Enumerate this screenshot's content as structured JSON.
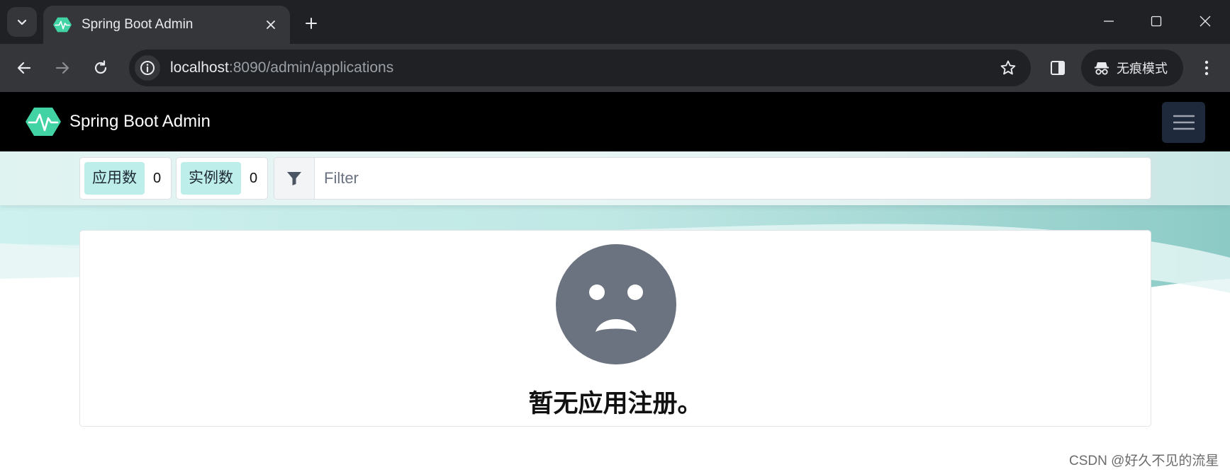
{
  "browser": {
    "tab": {
      "title": "Spring Boot Admin"
    },
    "address_bar": {
      "host": "localhost",
      "path": ":8090/admin/applications"
    },
    "incognito_label": "无痕模式",
    "icons": {
      "tab_search": "chevron-down-icon",
      "tab_close": "close-icon",
      "new_tab": "plus-icon",
      "minimize": "minimize-icon",
      "maximize": "maximize-icon",
      "close_window": "close-icon",
      "back": "arrow-left-icon",
      "forward": "arrow-right-icon",
      "reload": "reload-icon",
      "site_info": "info-icon",
      "bookmark": "star-icon",
      "side_panel": "side-panel-icon",
      "incognito": "incognito-icon",
      "menu": "kebab-menu-icon"
    }
  },
  "app": {
    "brand_title": "Spring Boot Admin",
    "header_bg": "#000000",
    "accent": "#42d3a5",
    "stats": {
      "applications_label": "应用数",
      "applications_value": "0",
      "instances_label": "实例数",
      "instances_value": "0"
    },
    "filter": {
      "placeholder": "Filter"
    },
    "empty_state": {
      "message": "暂无应用注册。",
      "icon": "sad-face-icon",
      "icon_color": "#6b7280"
    }
  },
  "watermark": "CSDN @好久不见的流星"
}
